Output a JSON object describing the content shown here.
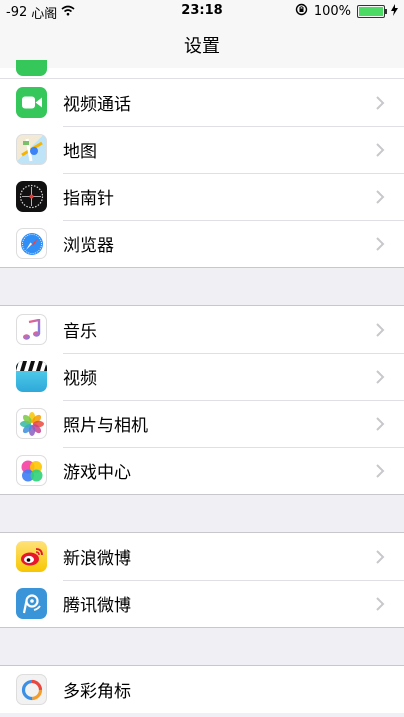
{
  "status_bar": {
    "signal": "-92",
    "carrier": "心阁",
    "time": "23:18",
    "battery": "100%",
    "battery_level": 1.0
  },
  "nav": {
    "title": "设置"
  },
  "groups": [
    {
      "items": [
        {
          "label": "视频通话",
          "icon": "facetime-icon"
        },
        {
          "label": "地图",
          "icon": "maps-icon"
        },
        {
          "label": "指南针",
          "icon": "compass-icon"
        },
        {
          "label": "浏览器",
          "icon": "safari-icon"
        }
      ]
    },
    {
      "items": [
        {
          "label": "音乐",
          "icon": "music-icon"
        },
        {
          "label": "视频",
          "icon": "videos-icon"
        },
        {
          "label": "照片与相机",
          "icon": "photos-icon"
        },
        {
          "label": "游戏中心",
          "icon": "game-center-icon"
        }
      ]
    },
    {
      "items": [
        {
          "label": "新浪微博",
          "icon": "sina-weibo-icon"
        },
        {
          "label": "腾讯微博",
          "icon": "tencent-weibo-icon"
        }
      ]
    },
    {
      "items": [
        {
          "label": "多彩角标",
          "icon": "colorful-badge-icon"
        }
      ]
    }
  ],
  "colors": {
    "battery_fill": "#4cd964",
    "chevron": "#c7c7cc",
    "background": "#efeff4"
  }
}
